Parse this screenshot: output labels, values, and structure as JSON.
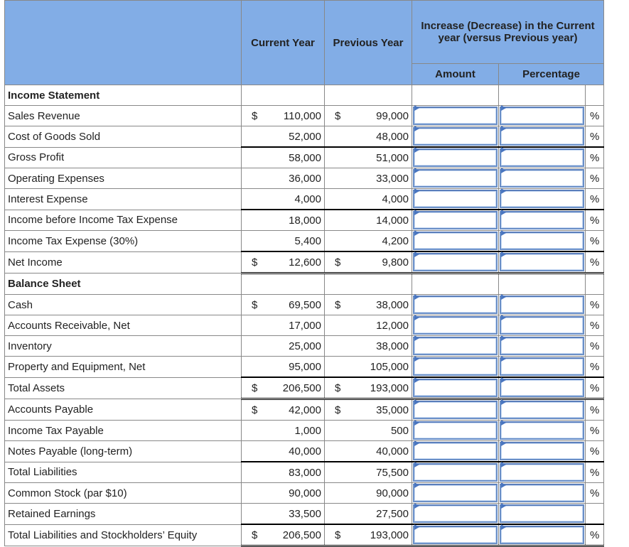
{
  "header": {
    "current_year": "Current Year",
    "previous_year": "Previous Year",
    "increase_title": "Increase (Decrease) in the Current year (versus Previous year)",
    "amount": "Amount",
    "percentage": "Percentage"
  },
  "currency_symbol": "$",
  "percent_symbol": "%",
  "sections": {
    "income_statement": "Income Statement",
    "balance_sheet": "Balance Sheet"
  },
  "rows": [
    {
      "label": "Sales Revenue",
      "cur": "110,000",
      "prev": "99,000",
      "dollar": true,
      "pct": true
    },
    {
      "label": "Cost of Goods Sold",
      "cur": "52,000",
      "prev": "48,000",
      "dollar": false,
      "pct": true
    },
    {
      "label": "Gross Profit",
      "cur": "58,000",
      "prev": "51,000",
      "dollar": false,
      "pct": true
    },
    {
      "label": "Operating Expenses",
      "cur": "36,000",
      "prev": "33,000",
      "dollar": false,
      "pct": true
    },
    {
      "label": "Interest Expense",
      "cur": "4,000",
      "prev": "4,000",
      "dollar": false,
      "pct": true
    },
    {
      "label": "Income before Income Tax Expense",
      "cur": "18,000",
      "prev": "14,000",
      "dollar": false,
      "pct": true
    },
    {
      "label": "Income Tax Expense (30%)",
      "cur": "5,400",
      "prev": "4,200",
      "dollar": false,
      "pct": true
    },
    {
      "label": "Net Income",
      "cur": "12,600",
      "prev": "9,800",
      "dollar": true,
      "pct": true
    },
    {
      "label": "Cash",
      "cur": "69,500",
      "prev": "38,000",
      "dollar": true,
      "pct": true
    },
    {
      "label": "Accounts Receivable, Net",
      "cur": "17,000",
      "prev": "12,000",
      "dollar": false,
      "pct": true
    },
    {
      "label": "Inventory",
      "cur": "25,000",
      "prev": "38,000",
      "dollar": false,
      "pct": true
    },
    {
      "label": "Property and Equipment, Net",
      "cur": "95,000",
      "prev": "105,000",
      "dollar": false,
      "pct": true
    },
    {
      "label": "Total Assets",
      "cur": "206,500",
      "prev": "193,000",
      "dollar": true,
      "pct": true
    },
    {
      "label": "Accounts Payable",
      "cur": "42,000",
      "prev": "35,000",
      "dollar": true,
      "pct": true
    },
    {
      "label": "Income Tax Payable",
      "cur": "1,000",
      "prev": "500",
      "dollar": false,
      "pct": true
    },
    {
      "label": "Notes Payable (long-term)",
      "cur": "40,000",
      "prev": "40,000",
      "dollar": false,
      "pct": true
    },
    {
      "label": "Total Liabilities",
      "cur": "83,000",
      "prev": "75,500",
      "dollar": false,
      "pct": true
    },
    {
      "label": "Common Stock (par $10)",
      "cur": "90,000",
      "prev": "90,000",
      "dollar": false,
      "pct": true
    },
    {
      "label": "Retained Earnings",
      "cur": "33,500",
      "prev": "27,500",
      "dollar": false,
      "pct": false
    },
    {
      "label": "Total Liabilities and Stockholders’ Equity",
      "cur": "206,500",
      "prev": "193,000",
      "dollar": true,
      "pct": true
    }
  ],
  "inputs": {
    "amount_value": "",
    "percentage_value": ""
  }
}
